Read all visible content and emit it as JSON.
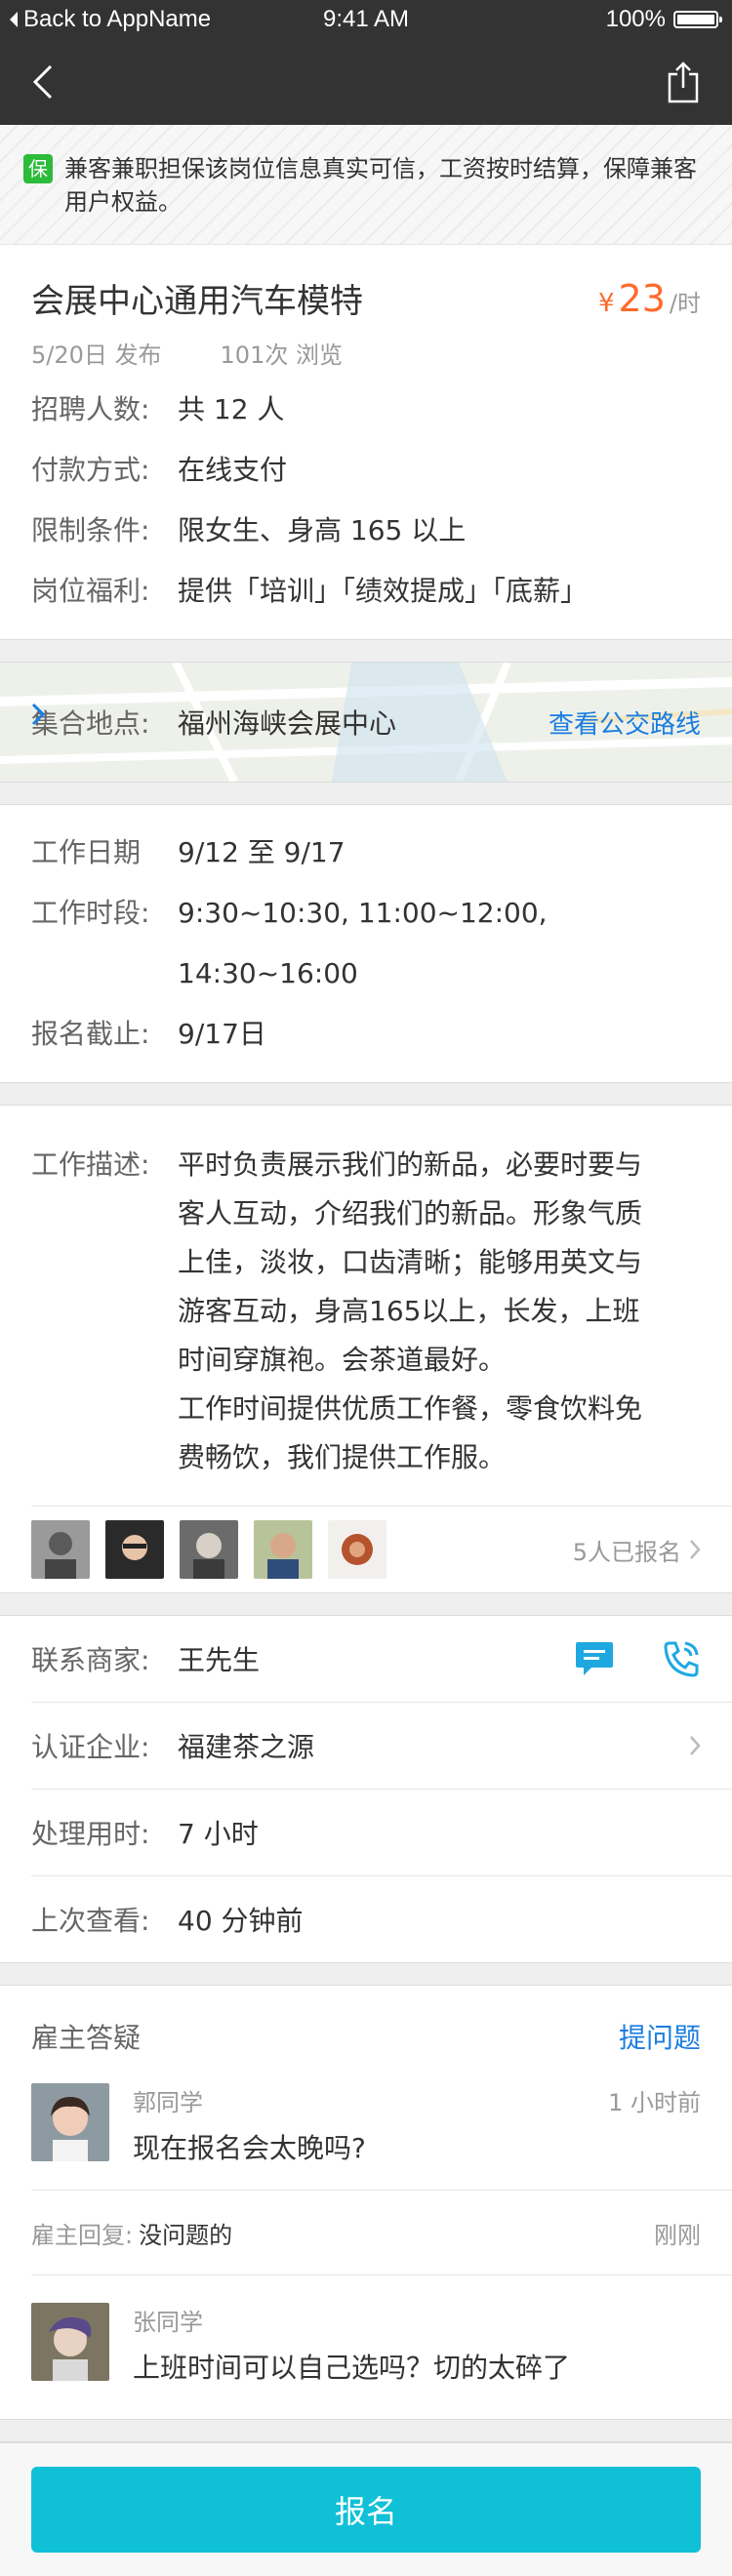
{
  "status_bar": {
    "back_label": "Back to AppName",
    "time": "9:41 AM",
    "battery": "100%"
  },
  "notice": {
    "badge": "保",
    "text": "兼客兼职担保该岗位信息真实可信，工资按时结算，保障兼客用户权益。"
  },
  "job": {
    "title": "会展中心通用汽车模特",
    "price_symbol": "¥",
    "price_value": "23",
    "price_unit": "/时",
    "posted": "5/20日 发布",
    "views": "101次 浏览",
    "details": [
      {
        "k": "招聘人数:",
        "v": "共 12 人"
      },
      {
        "k": "付款方式:",
        "v": "在线支付"
      },
      {
        "k": "限制条件:",
        "v": "限女生、身高 165 以上"
      },
      {
        "k": "岗位福利:",
        "v": "提供「培训」「绩效提成」「底薪」"
      }
    ]
  },
  "location": {
    "k": "集合地点:",
    "v": "福州海峡会展中心",
    "route_label": "查看公交路线"
  },
  "schedule": [
    {
      "k": "工作日期",
      "v": "9/12 至 9/17"
    },
    {
      "k": "工作时段:",
      "v": "9:30~10:30, 11:00~12:00, 14:30~16:00"
    },
    {
      "k": "报名截止:",
      "v": "9/17日"
    }
  ],
  "description": {
    "k": "工作描述:",
    "lines": [
      "平时负责展示我们的新品，必要时要与",
      "客人互动，介绍我们的新品。形象气质",
      "上佳，淡妆，口齿清晰；能够用英文与",
      "游客互动，身高165以上，长发，上班",
      "时间穿旗袍。会茶道最好。",
      "工作时间提供优质工作餐，零食饮料免",
      "费畅饮，我们提供工作服。"
    ]
  },
  "applicants": {
    "count_label": "5人已报名"
  },
  "contact": [
    {
      "k": "联系商家:",
      "v": "王先生"
    },
    {
      "k": "认证企业:",
      "v": "福建茶之源"
    },
    {
      "k": "处理用时:",
      "v": "7 小时"
    },
    {
      "k": "上次查看:",
      "v": "40 分钟前"
    }
  ],
  "qa": {
    "title": "雇主答疑",
    "ask_label": "提问题",
    "items": [
      {
        "name": "郭同学",
        "time": "1 小时前",
        "text": "现在报名会太晚吗?"
      },
      {
        "name": "张同学",
        "time": "",
        "text": "上班时间可以自己选吗？切的太碎了"
      }
    ],
    "reply": {
      "label": "雇主回复:",
      "text": "没问题的",
      "time": "刚刚"
    }
  },
  "footer": {
    "button_label": "报名"
  },
  "colors": {
    "accent_blue": "#1a7de0",
    "price_orange": "#ff6a2c",
    "button_cyan": "#10c0d6",
    "badge_green": "#2dbb3a"
  }
}
